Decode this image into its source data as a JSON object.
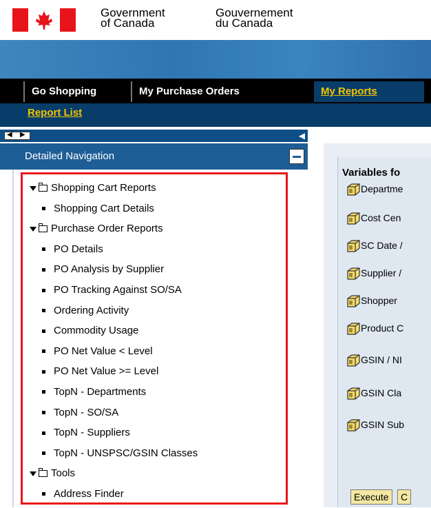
{
  "gov": {
    "en_line1": "Government",
    "en_line2": "of Canada",
    "fr_line1": "Gouvernement",
    "fr_line2": "du Canada"
  },
  "tabs": [
    {
      "label": "Go Shopping"
    },
    {
      "label": "My Purchase Orders"
    },
    {
      "label": "My Reports"
    }
  ],
  "subnav": {
    "label": "Report List"
  },
  "nav": {
    "header": "Detailed Navigation",
    "tree": [
      {
        "type": "folder",
        "label": "Shopping Cart Reports"
      },
      {
        "type": "leaf",
        "label": "Shopping Cart Details"
      },
      {
        "type": "folder",
        "label": "Purchase Order Reports"
      },
      {
        "type": "leaf",
        "label": "PO Details"
      },
      {
        "type": "leaf",
        "label": "PO Analysis by Supplier"
      },
      {
        "type": "leaf",
        "label": "PO Tracking Against SO/SA"
      },
      {
        "type": "leaf",
        "label": "Ordering Activity"
      },
      {
        "type": "leaf",
        "label": "Commodity Usage"
      },
      {
        "type": "leaf",
        "label": "PO Net Value < Level"
      },
      {
        "type": "leaf",
        "label": "PO Net Value >= Level"
      },
      {
        "type": "leaf",
        "label": "TopN - Departments"
      },
      {
        "type": "leaf",
        "label": "TopN - SO/SA"
      },
      {
        "type": "leaf",
        "label": "TopN - Suppliers"
      },
      {
        "type": "leaf",
        "label": "TopN - UNSPSC/GSIN Classes"
      },
      {
        "type": "folder",
        "label": "Tools"
      },
      {
        "type": "leaf",
        "label": "Address Finder"
      }
    ]
  },
  "variables": {
    "title": "Variables fo",
    "items": [
      "Departme",
      "Cost Cen",
      "SC Date /",
      "Supplier /",
      "Shopper",
      "Product C",
      "GSIN / NI",
      "GSIN Cla",
      "GSIN Sub"
    ],
    "execute_label": "Execute",
    "second_button_label": "C"
  },
  "colors": {
    "flag_red": "#e8141b",
    "tab_active_text": "#f3c300",
    "nav_header_bg": "#1e5d96",
    "highlight_border": "#e8141b"
  }
}
